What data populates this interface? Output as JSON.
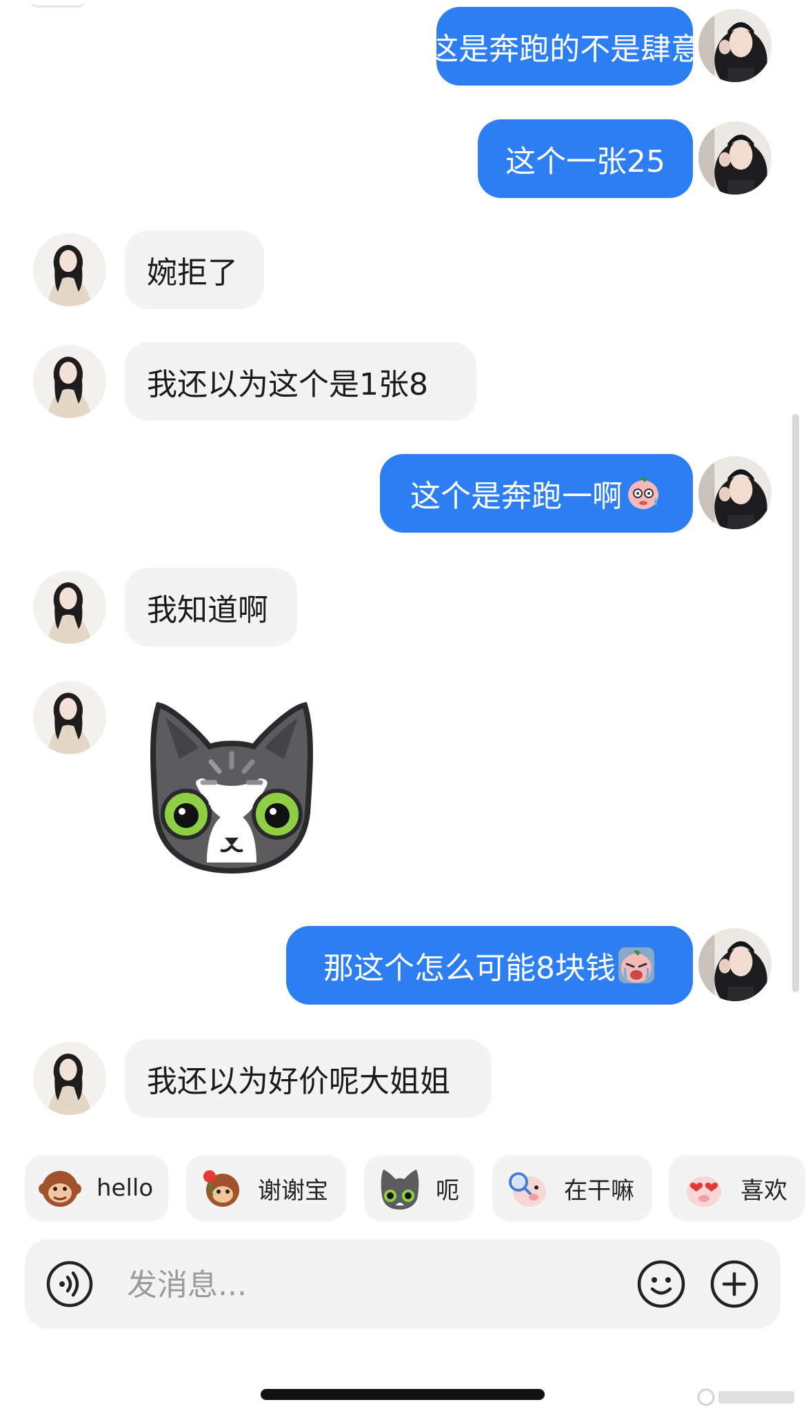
{
  "messages": [
    {
      "side": "sent",
      "text": "这是奔跑的不是肆意"
    },
    {
      "side": "sent",
      "text": "这个一张25"
    },
    {
      "side": "recv",
      "text": "婉拒了"
    },
    {
      "side": "recv",
      "text": "我还以为这个是1张8"
    },
    {
      "side": "sent",
      "text": "这个是奔跑一啊",
      "emoji": "sweating-pink-face-emoji"
    },
    {
      "side": "recv",
      "text": "我知道啊"
    },
    {
      "side": "recv",
      "sticker": "gray-cat-loading-sticker"
    },
    {
      "side": "sent",
      "text": "那这个怎么可能8块钱",
      "emoji": "crying-pink-face-emoji"
    },
    {
      "side": "recv",
      "text": "我还以为好价呢大姐姐"
    }
  ],
  "quick_replies": [
    {
      "label": "hello",
      "icon": "monkey-emoji-icon"
    },
    {
      "label": "谢谢宝",
      "icon": "monkey-rose-emoji-icon"
    },
    {
      "label": "呃",
      "icon": "gray-cat-emoji-icon"
    },
    {
      "label": "在干嘛",
      "icon": "pig-magnifier-emoji-icon"
    },
    {
      "label": "喜欢",
      "icon": "pig-heart-emoji-icon"
    }
  ],
  "composer": {
    "placeholder": "发消息..."
  },
  "colors": {
    "sent_bubble": "#2d7ef3",
    "received_bubble": "#f3f3f3",
    "chip_bg": "#f3f3f3"
  }
}
